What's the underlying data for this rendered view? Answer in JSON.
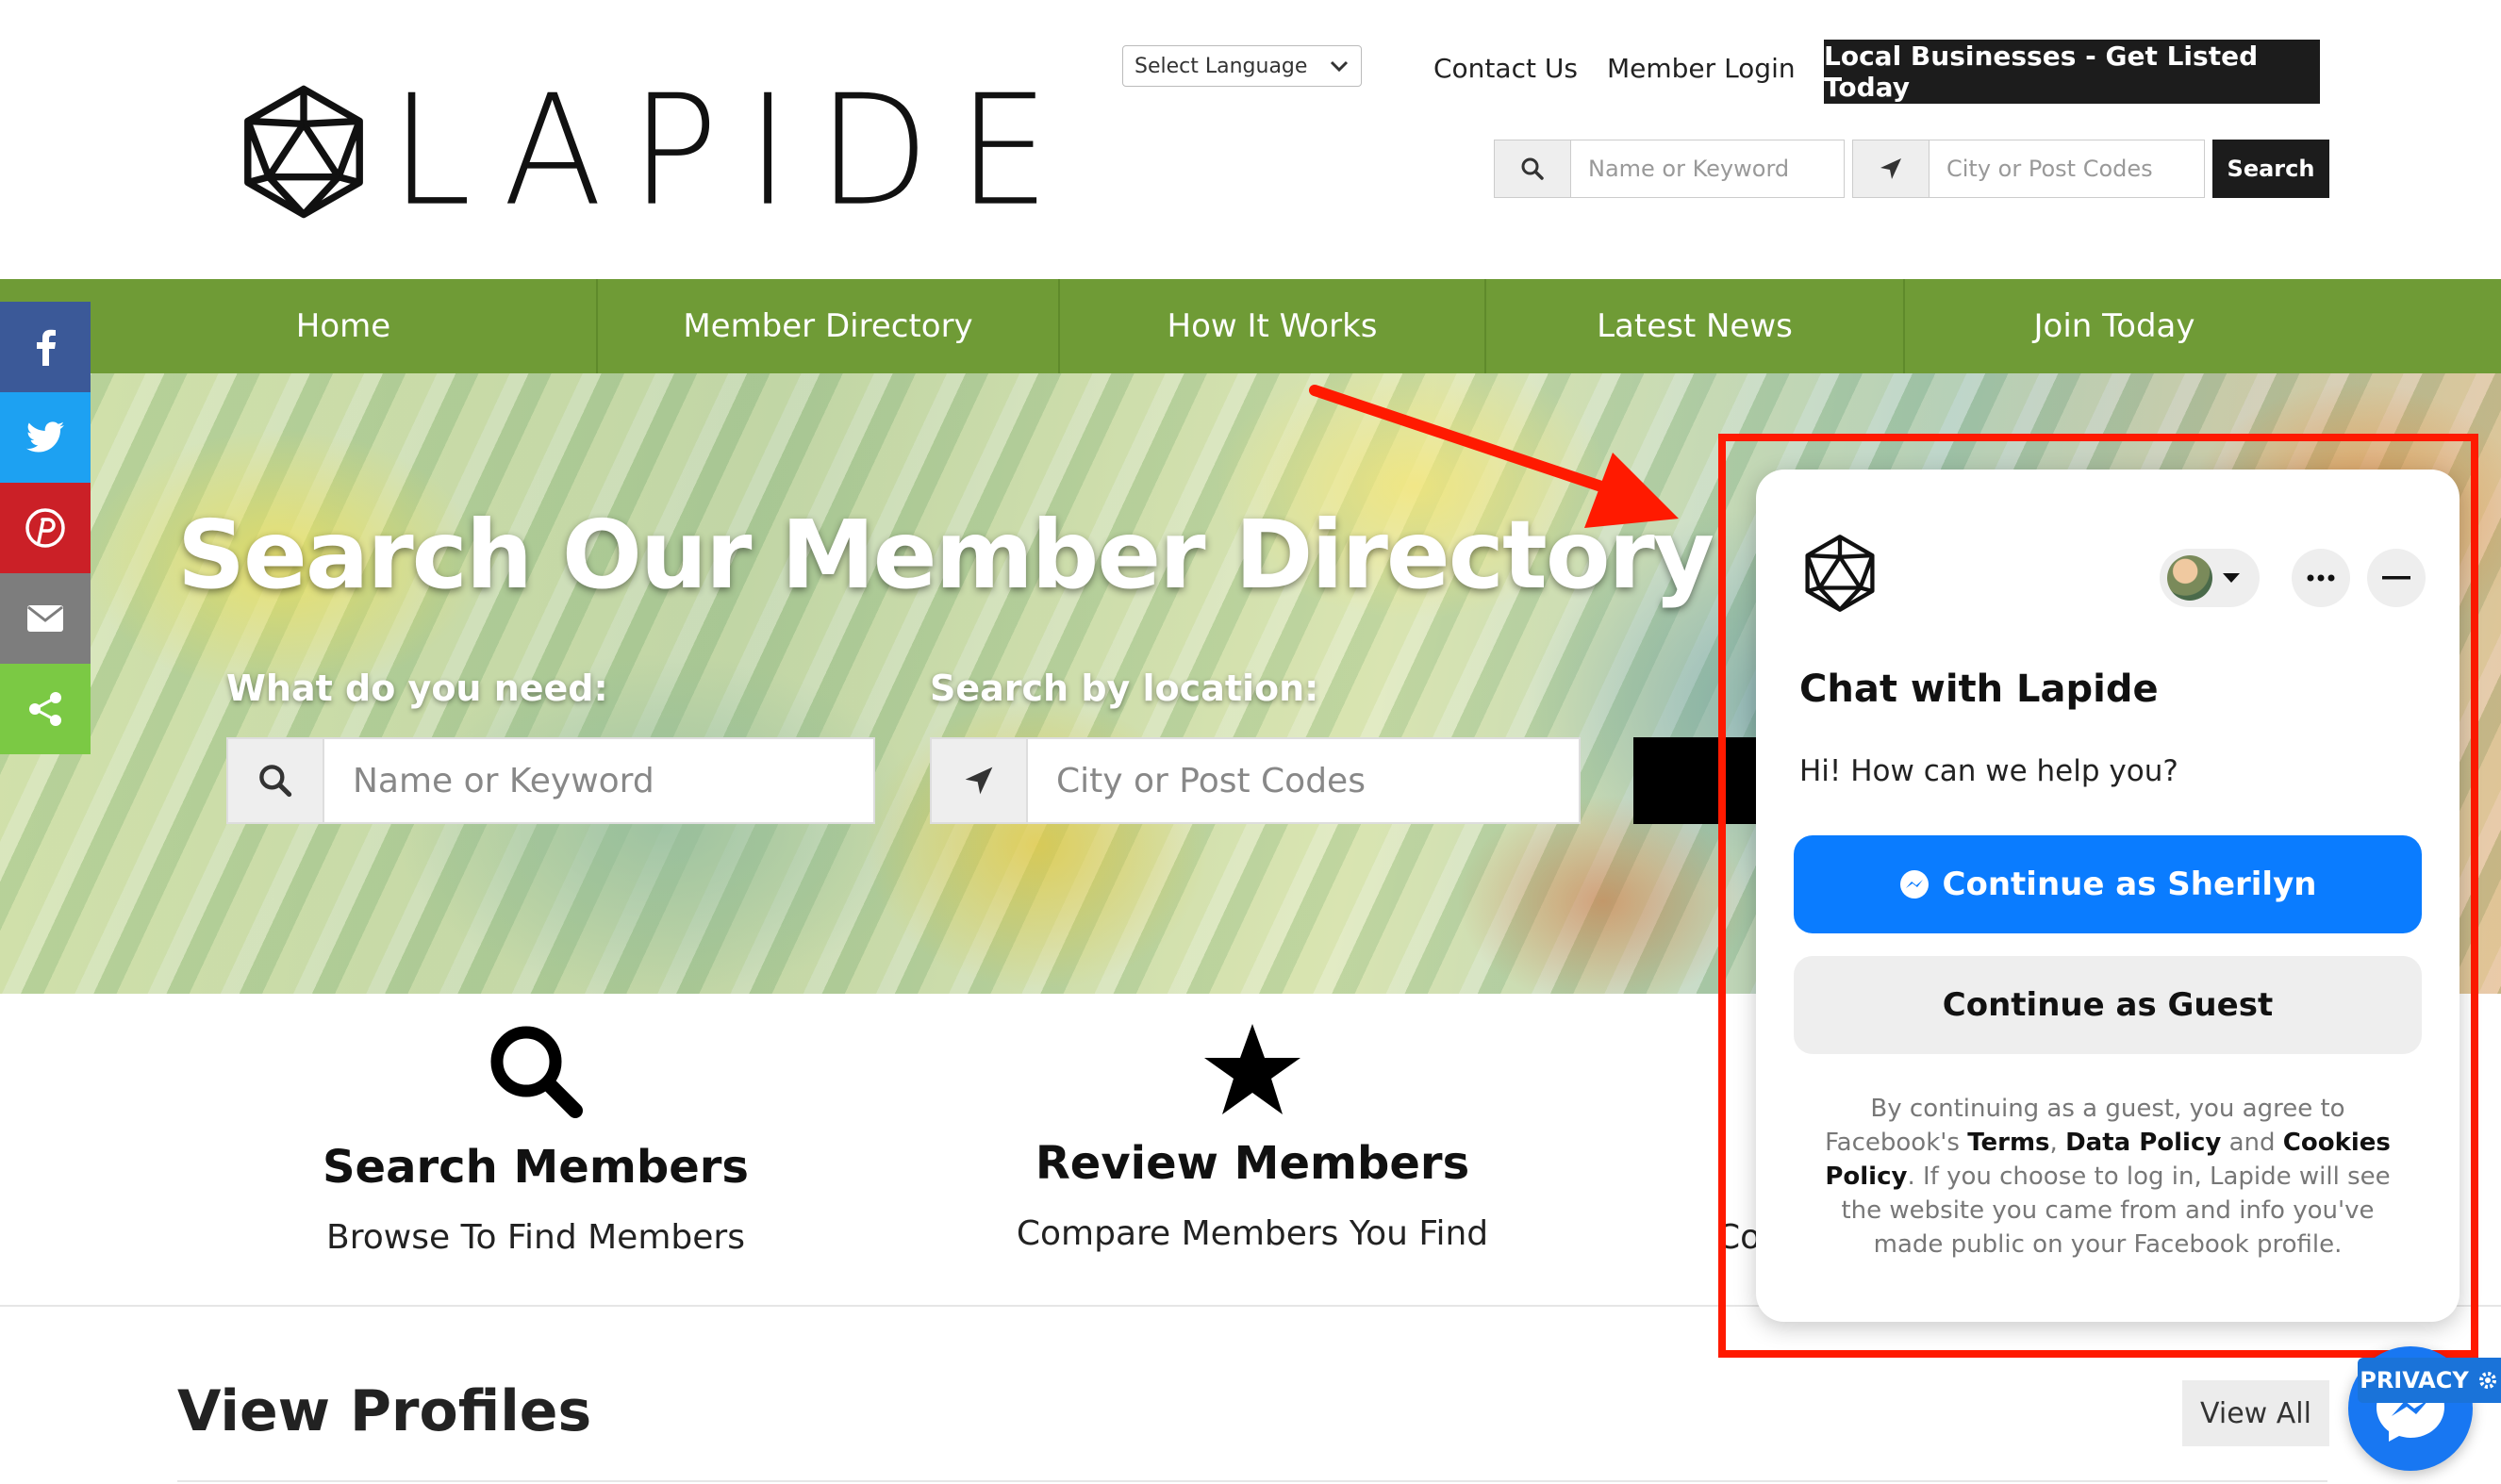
{
  "header": {
    "logo_text": "LAPIDE",
    "language_select": "Select Language",
    "contact_link": "Contact Us",
    "login_link": "Member Login",
    "cta": "Local Businesses - Get Listed Today",
    "search": {
      "keyword_placeholder": "Name or Keyword",
      "location_placeholder": "City or Post Codes",
      "button": "Search"
    }
  },
  "nav": {
    "items": [
      {
        "label": "Home"
      },
      {
        "label": "Member Directory"
      },
      {
        "label": "How It Works"
      },
      {
        "label": "Latest News"
      },
      {
        "label": "Join Today"
      }
    ]
  },
  "social": {
    "buttons": [
      {
        "icon": "facebook-icon",
        "color": "#3b5998"
      },
      {
        "icon": "twitter-icon",
        "color": "#1da1f2"
      },
      {
        "icon": "pinterest-icon",
        "color": "#cb2027"
      },
      {
        "icon": "email-icon",
        "color": "#7d7d7d"
      },
      {
        "icon": "share-icon",
        "color": "#7bc944"
      }
    ]
  },
  "hero": {
    "title": "Search Our Member Directory",
    "need_label": "What do you need:",
    "location_label": "Search by location:",
    "keyword_placeholder": "Name or Keyword",
    "location_placeholder": "City or Post Codes"
  },
  "features": [
    {
      "icon": "search-icon",
      "title": "Search Members",
      "subtitle": "Browse To Find Members"
    },
    {
      "icon": "star-icon",
      "title": "Review Members",
      "subtitle": "Compare Members You Find"
    }
  ],
  "feature_cut_text": "Co",
  "profiles": {
    "title": "View Profiles",
    "view_all": "View All"
  },
  "chat": {
    "title": "Chat with Lapide",
    "message": "Hi! How can we help you?",
    "continue_fb": "Continue as Sherilyn",
    "continue_guest": "Continue as Guest",
    "legal": {
      "part1": "By continuing as a guest, you agree to Facebook's ",
      "terms": "Terms",
      "comma": ", ",
      "data_policy": "Data Policy",
      "and": " and ",
      "cookies_policy": "Cookies Policy",
      "part2": ". If you choose to log in, Lapide will see the website you came from and info you've made public on your Facebook profile."
    }
  },
  "privacy_label": "PRIVACY",
  "colors": {
    "nav_green": "#6f9b36",
    "annotation_red": "#ff1a00",
    "messenger_blue": "#0a7cff"
  }
}
